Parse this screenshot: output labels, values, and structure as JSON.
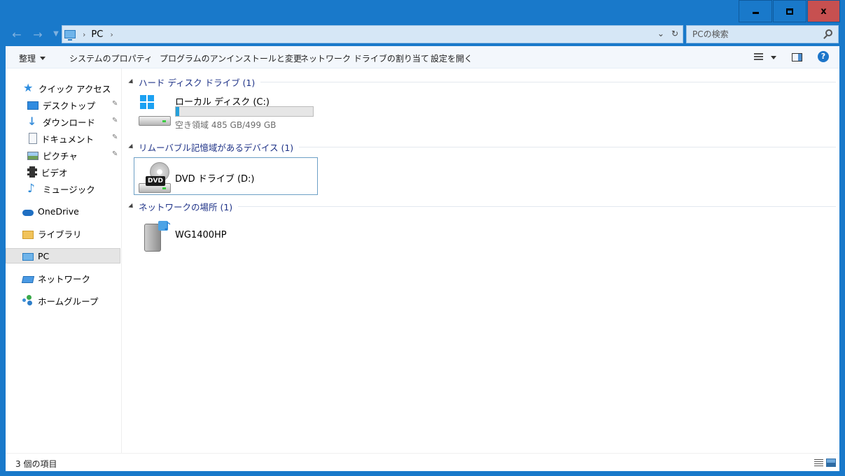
{
  "window": {
    "min_label": "",
    "max_label": "",
    "close_label": "x"
  },
  "address": {
    "path": "PC",
    "search_placeholder": "PCの検索"
  },
  "ribbon": {
    "organize": "整理",
    "system_properties": "システムのプロパティ",
    "uninstall": "プログラムのアンインストールと変更",
    "map_network_drive": "ネットワーク ドライブの割り当て",
    "open_settings": "設定を開く"
  },
  "sidebar": {
    "quick_access": "クイック アクセス",
    "items": [
      {
        "label": "デスクトップ",
        "icon": "desktop-icon",
        "pinned": true
      },
      {
        "label": "ダウンロード",
        "icon": "download-icon",
        "pinned": true
      },
      {
        "label": "ドキュメント",
        "icon": "document-icon",
        "pinned": true
      },
      {
        "label": "ピクチャ",
        "icon": "picture-icon",
        "pinned": true
      },
      {
        "label": "ビデオ",
        "icon": "video-icon",
        "pinned": false
      },
      {
        "label": "ミュージック",
        "icon": "music-icon",
        "pinned": false
      }
    ],
    "onedrive": "OneDrive",
    "libraries": "ライブラリ",
    "pc": "PC",
    "network": "ネットワーク",
    "homegroup": "ホームグループ"
  },
  "groups": {
    "hdd": {
      "header": "ハード ディスク ドライブ (1)",
      "drive_name": "ローカル ディスク (C:)",
      "free_text": "空き領域 485 GB/499 GB",
      "used_fraction": 0.028
    },
    "removable": {
      "header": "リムーバブル記憶域があるデバイス (1)",
      "drive_name": "DVD ドライブ (D:)",
      "dvd_badge": "DVD"
    },
    "network": {
      "header": "ネットワークの場所 (1)",
      "device_name": "WG1400HP"
    }
  },
  "status": {
    "item_count": "3 個の項目"
  },
  "colors": {
    "chrome": "#1979ca",
    "close": "#c75050",
    "group_header": "#1e3287",
    "usage_bar": "#26a0da"
  }
}
